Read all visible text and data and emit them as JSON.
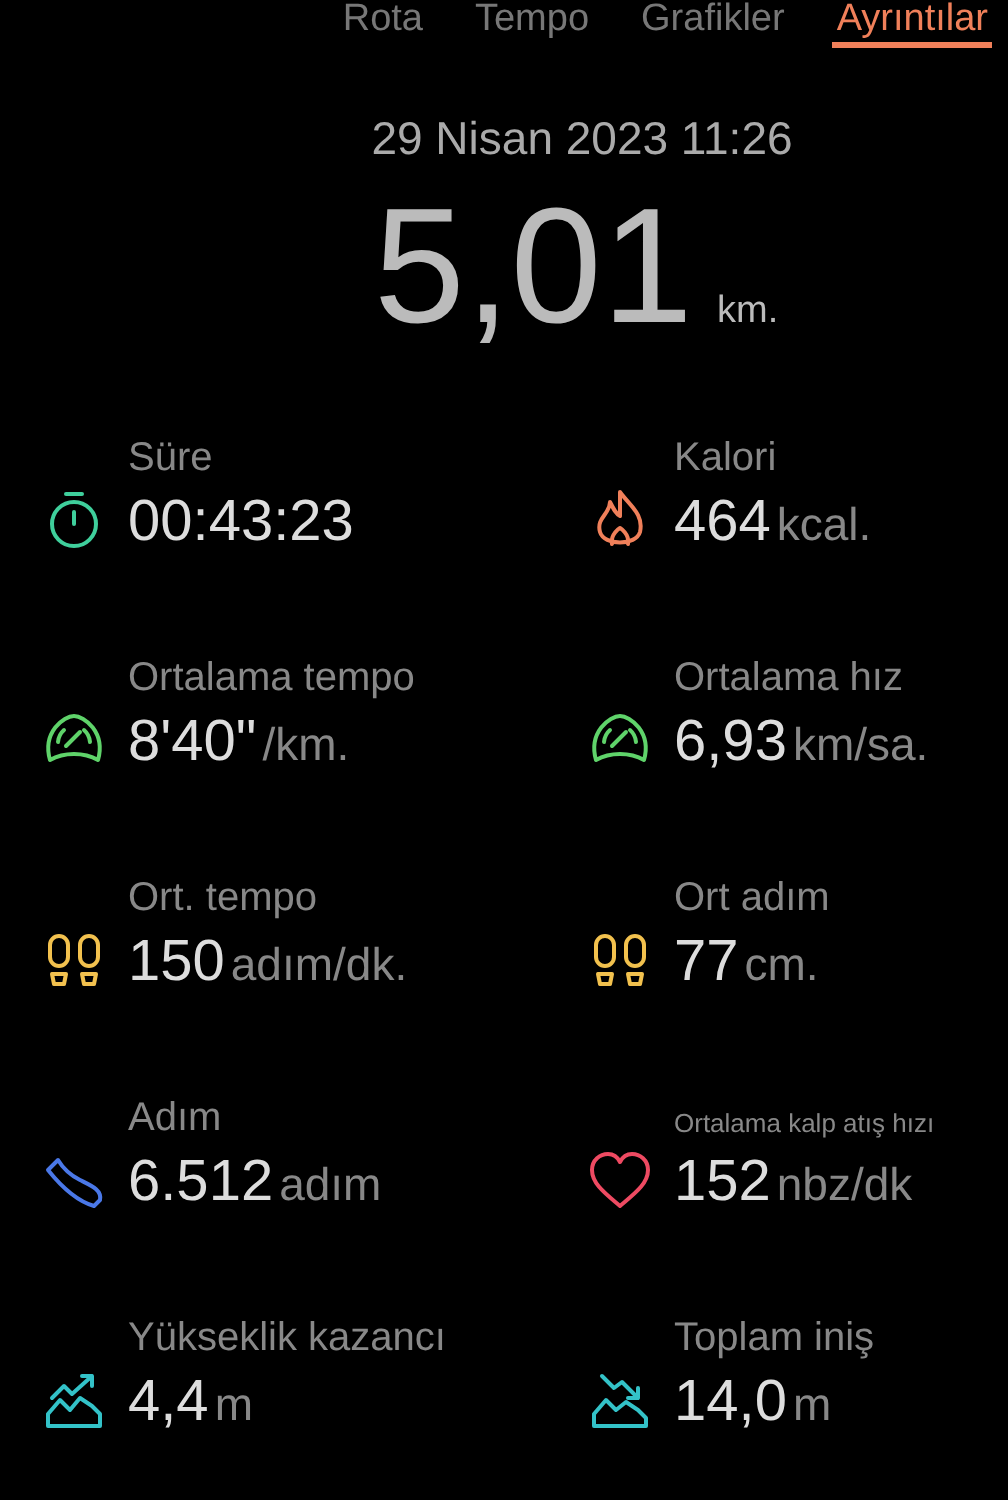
{
  "tabs": [
    {
      "label": "Rota",
      "selected": false
    },
    {
      "label": "Tempo",
      "selected": false
    },
    {
      "label": "Grafikler",
      "selected": false
    },
    {
      "label": "Ayrıntılar",
      "selected": true
    }
  ],
  "date": "29 Nisan 2023 11:26",
  "distance": {
    "value": "5,01",
    "unit": "km."
  },
  "stats": [
    {
      "kind": "stopwatch",
      "color": "#3fcf9c",
      "label": "Süre",
      "value": "00:43:23"
    },
    {
      "kind": "flame",
      "color": "#f0805a",
      "label": "Kalori",
      "value": "464",
      "unit": "kcal."
    },
    {
      "kind": "gauge",
      "color": "#5fd36a",
      "label": "Ortalama tempo",
      "value": "8'40\"",
      "unit": "/km."
    },
    {
      "kind": "gauge",
      "color": "#5fd36a",
      "label": "Ortalama hız",
      "value": "6,93",
      "unit": "km/sa."
    },
    {
      "kind": "footprints",
      "color": "#f2c14e",
      "label": "Ort. tempo",
      "value": "150",
      "unit": "adım/dk."
    },
    {
      "kind": "footprints",
      "color": "#f2c14e",
      "label": "Ort adım",
      "value": "77",
      "unit": "cm."
    },
    {
      "kind": "shoe",
      "color": "#4a78e8",
      "label": "Adım",
      "value": "6.512",
      "unit": "adım"
    },
    {
      "kind": "heart",
      "color": "#ee4a62",
      "label": "Ortalama kalp atış hızı",
      "compact": true,
      "value": "152",
      "unit": "nbz/dk"
    },
    {
      "kind": "climb",
      "color": "#33c2c8",
      "label": "Yükseklik kazancı",
      "value": "4,4",
      "unit": "m"
    },
    {
      "kind": "descent",
      "color": "#33c2c8",
      "label": "Toplam iniş",
      "value": "14,0",
      "unit": "m"
    }
  ]
}
